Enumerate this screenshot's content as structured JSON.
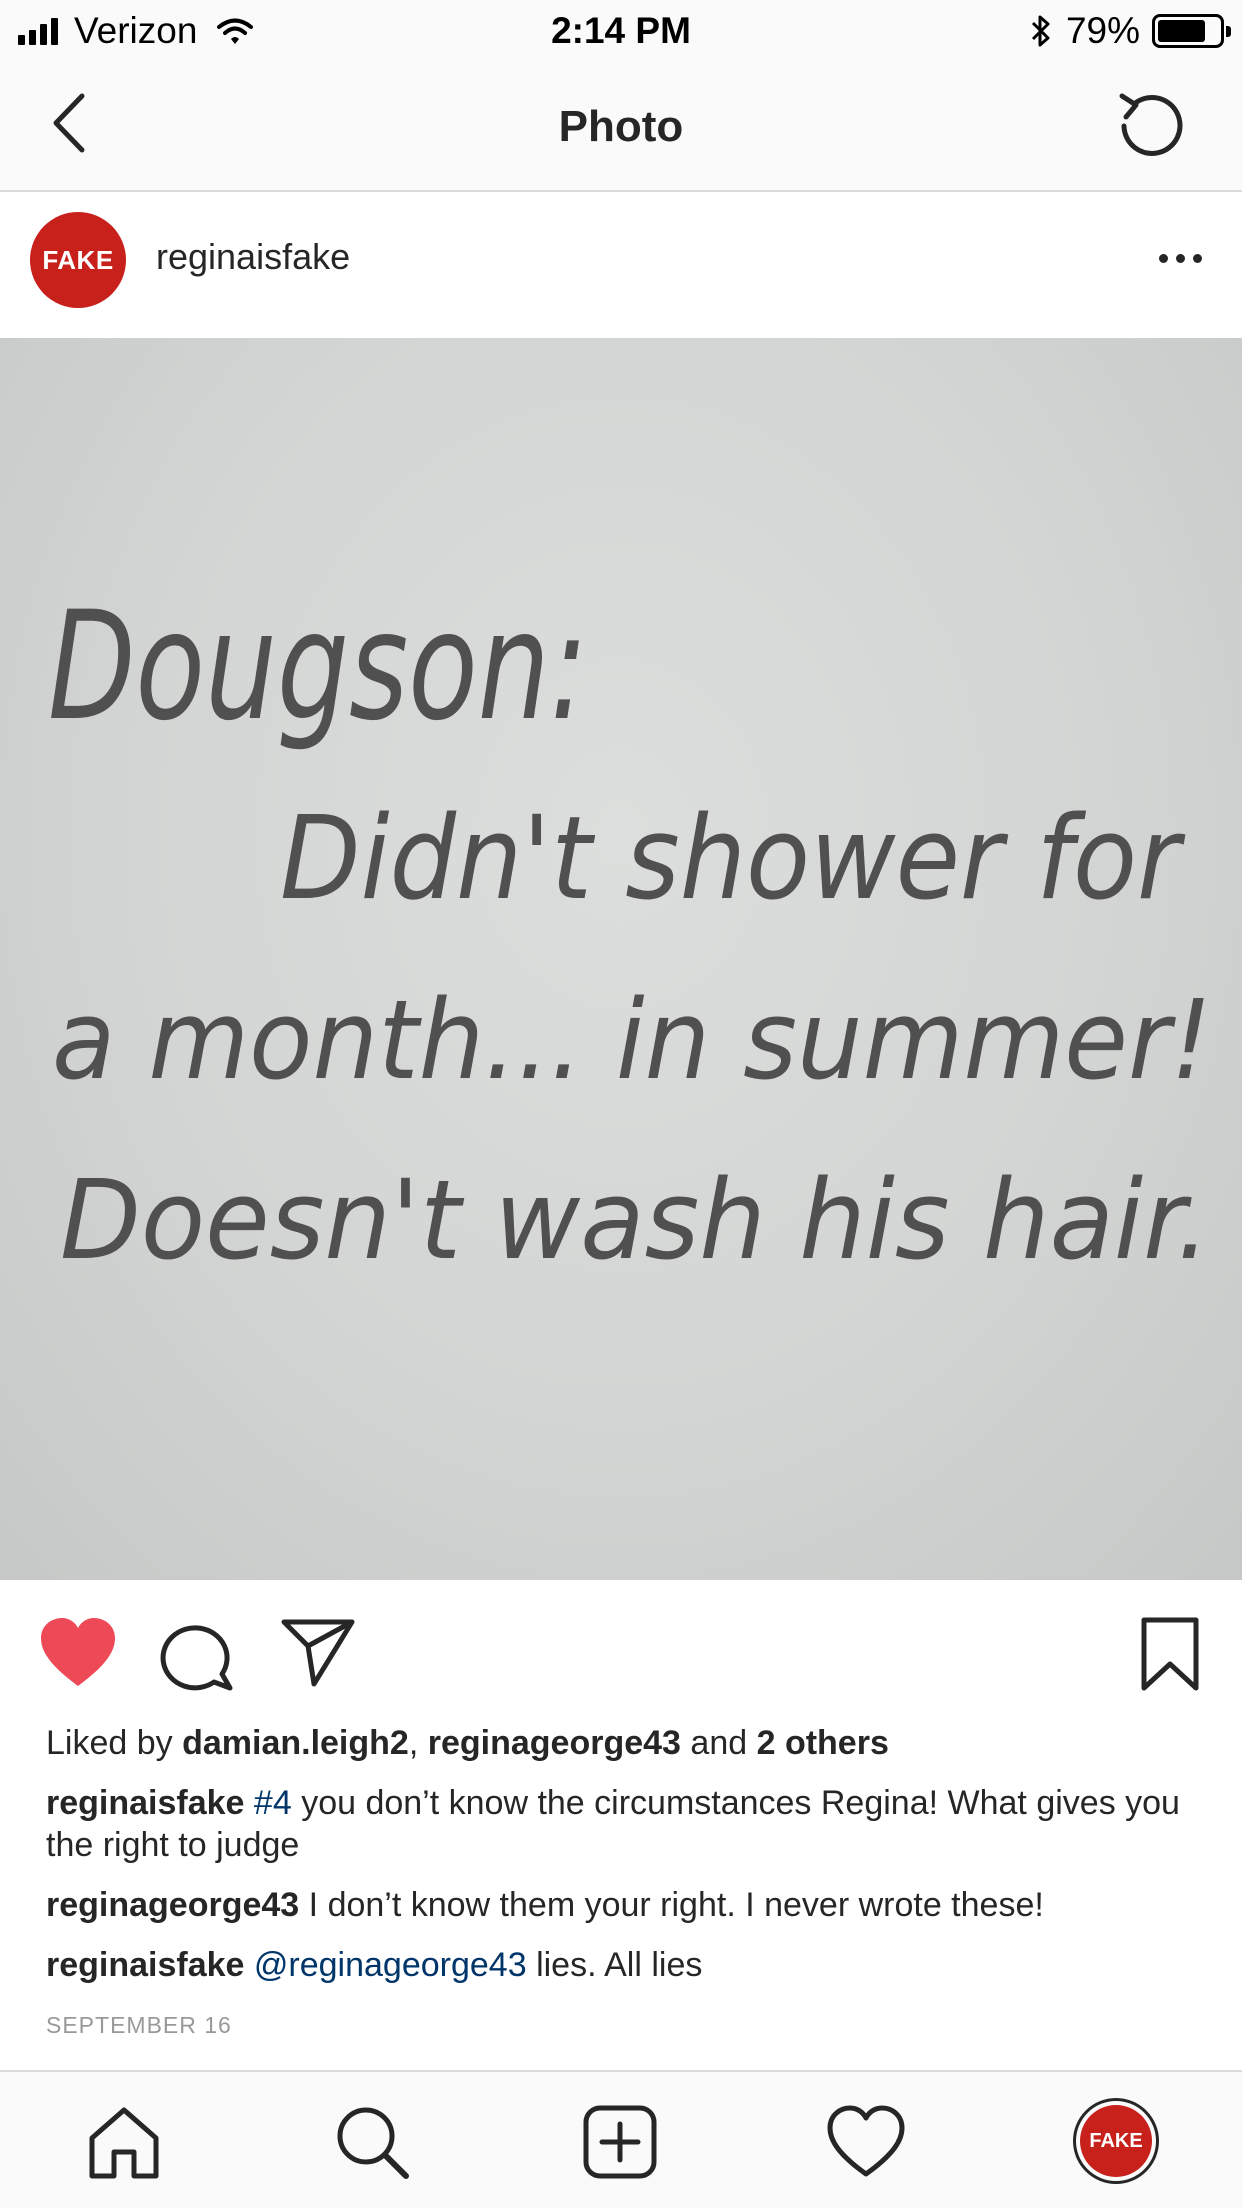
{
  "status_bar": {
    "carrier": "Verizon",
    "time": "2:14 PM",
    "battery": "79%",
    "battery_level": 0.79,
    "icons": [
      "signal-icon",
      "wifi-icon",
      "bluetooth-icon",
      "battery-icon"
    ]
  },
  "nav": {
    "title": "Photo",
    "back_icon": "chevron-left-icon",
    "refresh_icon": "refresh-icon"
  },
  "post": {
    "avatar_text": "FAKE",
    "avatar_color": "#c8201a",
    "username": "reginaisfake",
    "more_icon": "more-horizontal-icon",
    "photo_text": [
      "Dougson:",
      "Didn't shower for",
      "a month... in summer!",
      "Doesn't wash his hair."
    ]
  },
  "actions": {
    "icons": [
      "heart-filled-icon",
      "comment-icon",
      "share-icon",
      "bookmark-icon"
    ],
    "heart_color": "#ed4956"
  },
  "likes": {
    "prefix": "Liked by",
    "user1": "damian.leigh2",
    "sep": ",",
    "user2": "reginageorge43",
    "and": "and",
    "others": "2 others"
  },
  "comments": [
    {
      "user": "reginaisfake",
      "tag": "#4",
      "text": "you don’t know the circumstances Regina! What gives you the right to judge"
    },
    {
      "user": "reginageorge43",
      "text": "I don’t know them your right. I never wrote these!"
    },
    {
      "user": "reginaisfake",
      "tag": "@reginageorge43",
      "text": "lies. All lies"
    }
  ],
  "date": "SEPTEMBER 16",
  "tab_bar": {
    "icons": [
      "home-icon",
      "search-icon",
      "add-post-icon",
      "activity-heart-icon",
      "profile-avatar-icon"
    ],
    "avatar_text": "FAKE"
  }
}
